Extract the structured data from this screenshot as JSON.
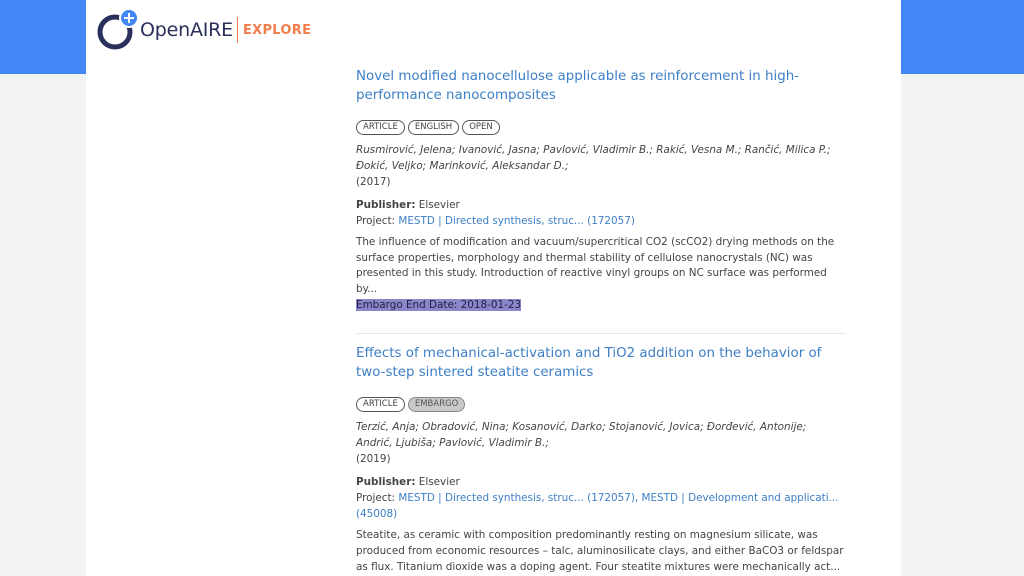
{
  "brand": {
    "name_open": "Open",
    "name_aire": "AIRE",
    "section": "EXPLORE",
    "colors": {
      "band": "#4287f5",
      "navy": "#2b2f5b",
      "orange": "#f07d4a",
      "link": "#3d7fc6"
    }
  },
  "results": [
    {
      "title": "Novel modified nanocellulose applicable as reinforcement in high-performance nanocomposites",
      "badges": [
        "ARTICLE",
        "ENGLISH",
        "OPEN"
      ],
      "authors": "Rusmirović, Jelena; Ivanović, Jasna; Pavlović, Vladimir B.; Rakić, Vesna M.; Rančić, Milica P.; Đokić, Veljko; Marinković, Aleksandar D.;",
      "year": "(2017)",
      "publisher_label": "Publisher:",
      "publisher": "Elsevier",
      "project_label": "Project:",
      "projects": "MESTD | Directed synthesis, struc... (172057)",
      "abstract": "The influence of modification and vacuum/supercritical CO2 (scCO2) drying methods on the surface properties, morphology and thermal stability of cellulose nanocrystals (NC) was presented in this study. Introduction of reactive vinyl groups on NC surface was performed by...",
      "embargo": "Embargo End Date: 2018-01-23"
    },
    {
      "title": "Effects of mechanical-activation and TiO2 addition on the behavior of two-step sintered steatite ceramics",
      "badges": [
        "ARTICLE",
        "EMBARGO"
      ],
      "authors": "Terzić, Anja; Obradović, Nina; Kosanović, Darko; Stojanović, Jovica; Đorđević, Antonije; Andrić, Ljubiša; Pavlović, Vladimir B.;",
      "year": "(2019)",
      "publisher_label": "Publisher:",
      "publisher": "Elsevier",
      "project_label": "Project:",
      "projects": "MESTD | Directed synthesis, struc... (172057), MESTD | Development and applicati... (45008)",
      "abstract": "Steatite, as ceramic with composition predominantly resting on magnesium silicate, was produced from economic resources – talc, aluminosilicate clays, and either BaCO3 or feldspar as flux. Titanium dioxide was a doping agent. Four steatite mixtures were mechanically act..."
    }
  ]
}
